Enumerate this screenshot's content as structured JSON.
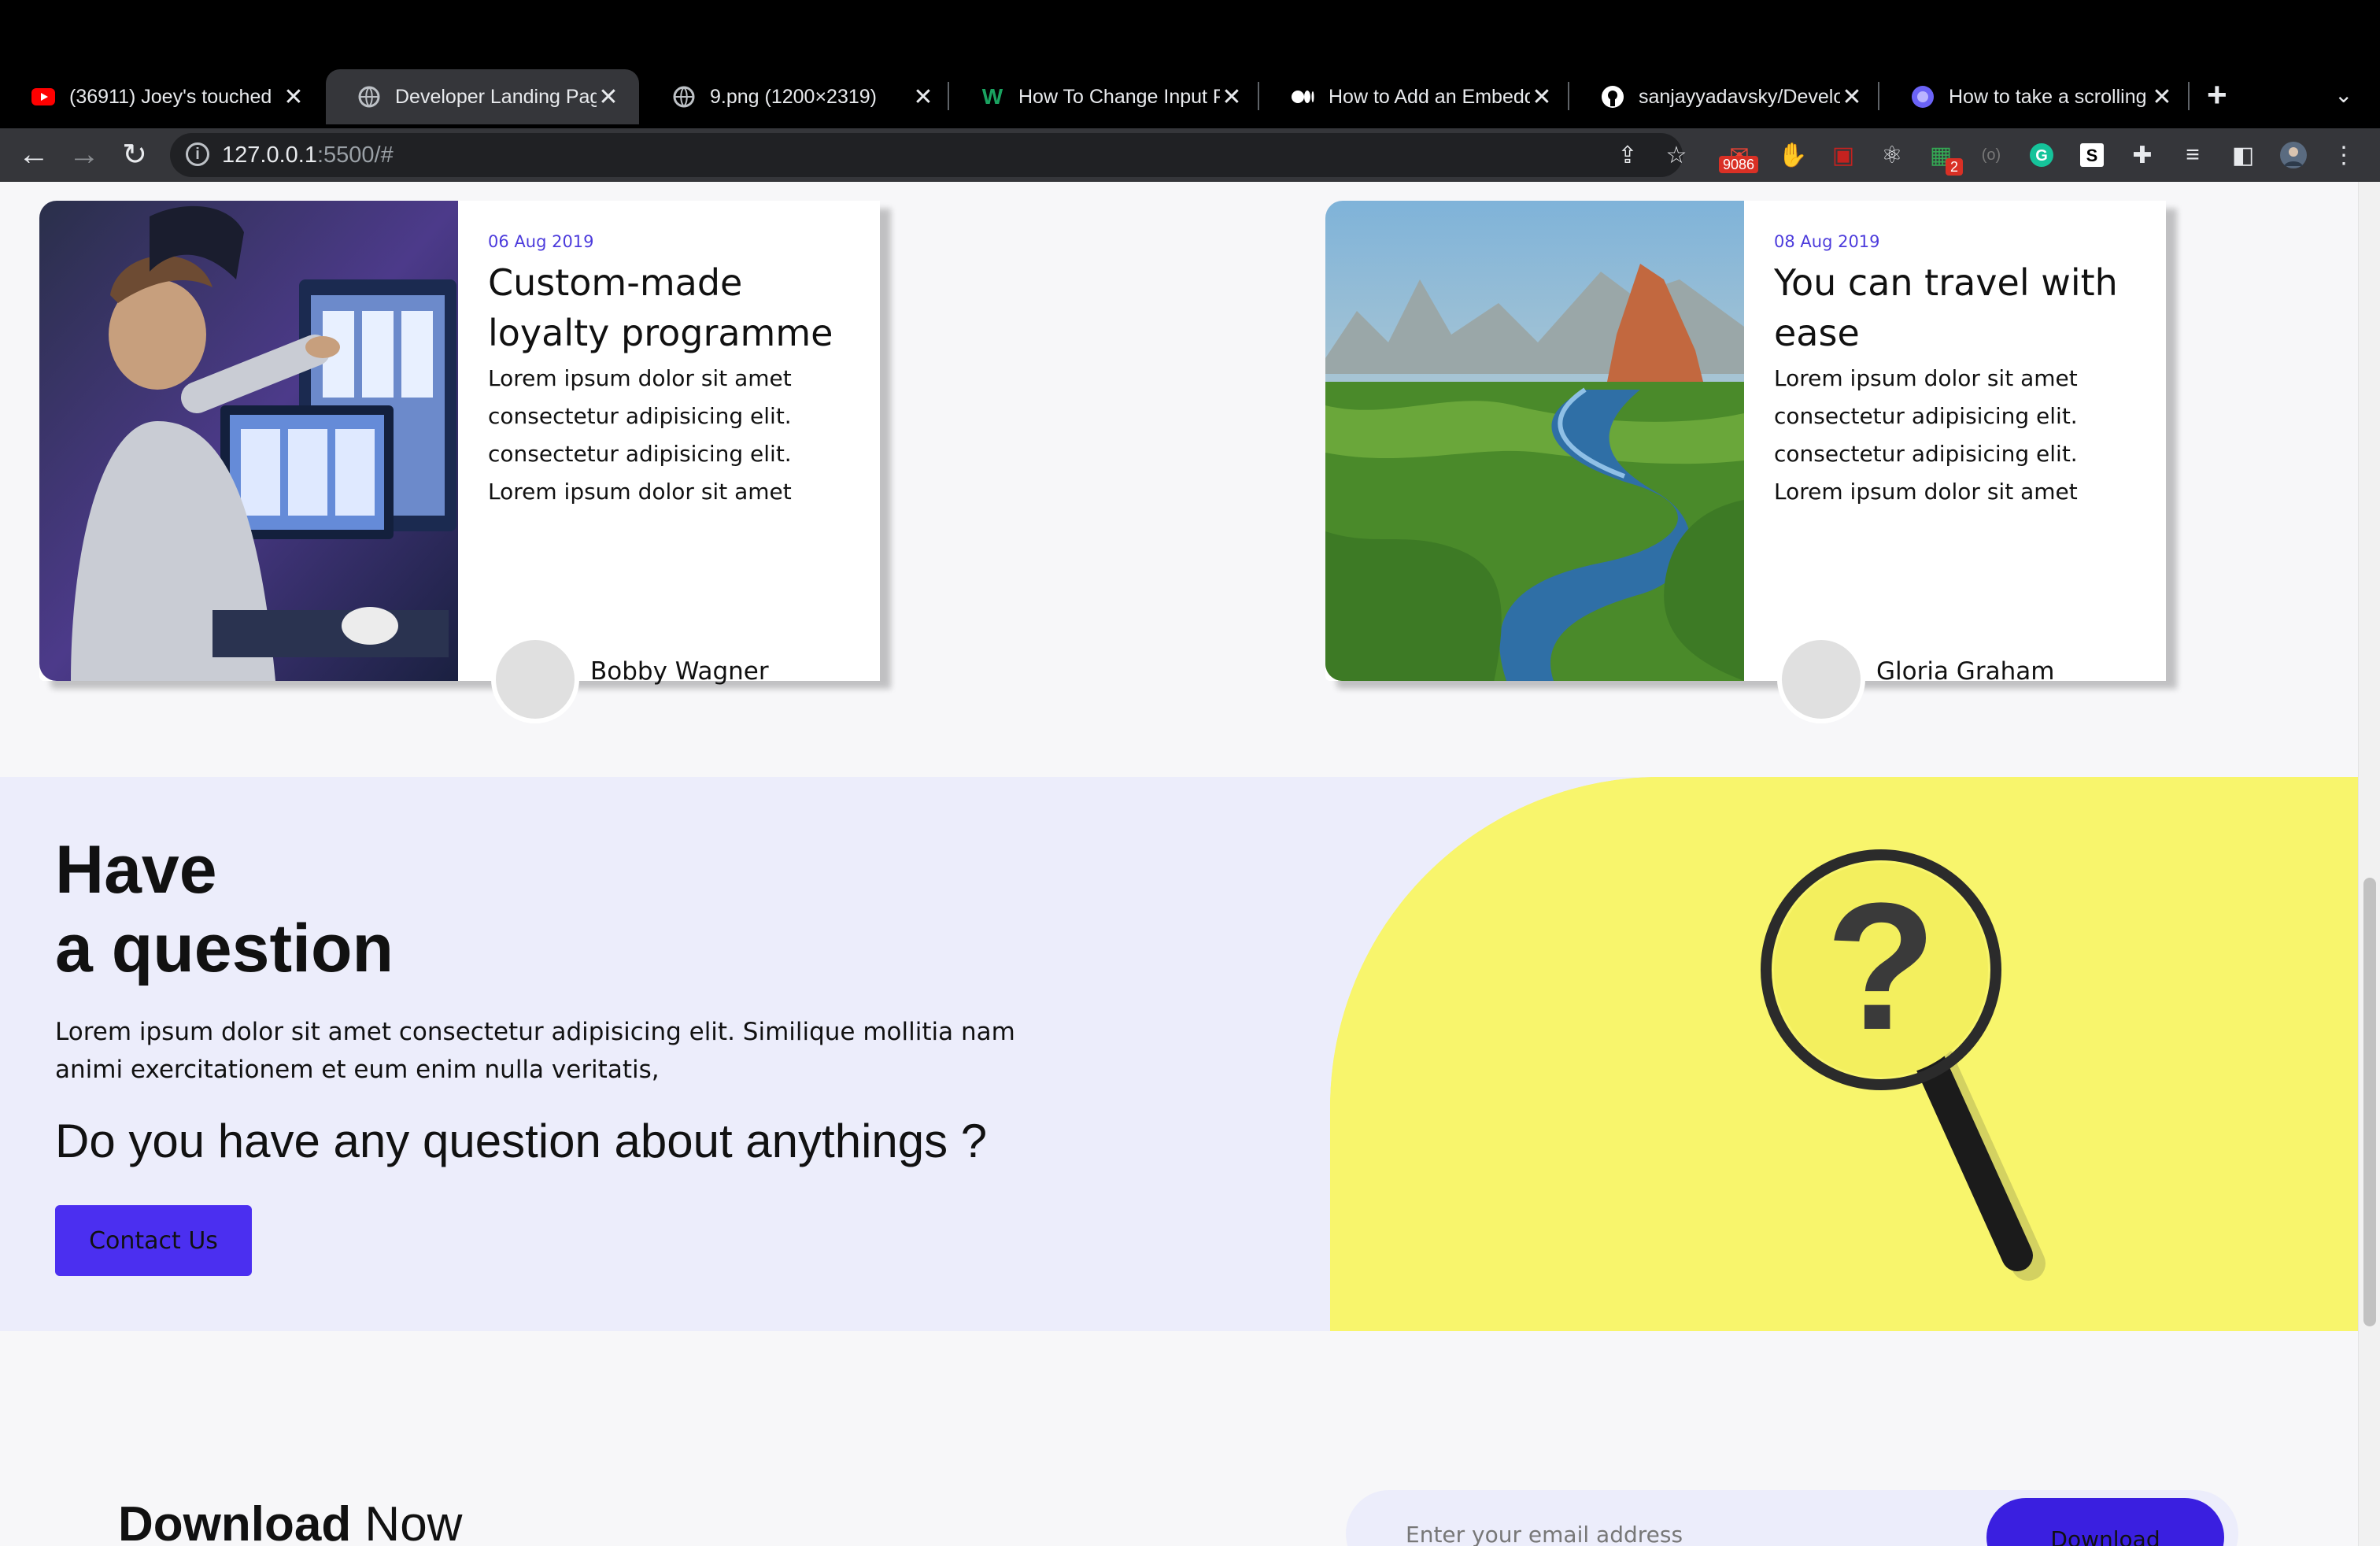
{
  "browser": {
    "tabs": [
      {
        "title": "(36911) Joey's touched",
        "icon": "youtube-icon"
      },
      {
        "title": "Developer Landing Page",
        "icon": "globe-icon",
        "active": true
      },
      {
        "title": "9.png (1200×2319)",
        "icon": "globe-icon"
      },
      {
        "title": "How To Change Input Placeholder",
        "icon": "w-logo-icon"
      },
      {
        "title": "How to Add an Embedded",
        "icon": "medium-icon"
      },
      {
        "title": "sanjayyadavsky/Developer",
        "icon": "github-icon"
      },
      {
        "title": "How to take a scrolling",
        "icon": "site-icon"
      }
    ],
    "url_host": "127.0.0.1",
    "url_rest": ":5500/#",
    "extension_badge": "9086",
    "extension_badge_small": "2"
  },
  "cards": [
    {
      "date": "06 Aug 2019",
      "title": "Custom-made loyalty programme",
      "lines": [
        "Lorem ipsum dolor sit amet",
        "consectetur adipisicing elit.",
        "consectetur adipisicing elit.",
        "Lorem ipsum dolor sit amet"
      ],
      "author": "Bobby Wagner",
      "image": "woman-at-monitors-photo"
    },
    {
      "date": "08 Aug 2019",
      "title": "You can travel with ease",
      "lines": [
        "Lorem ipsum dolor sit amet",
        "consectetur adipisicing elit.",
        "consectetur adipisicing elit.",
        "Lorem ipsum dolor sit amet"
      ],
      "author": "Gloria Graham",
      "image": "river-landscape-photo"
    }
  ],
  "question": {
    "heading_line1": "Have",
    "heading_line2": "a question",
    "paragraph": "Lorem ipsum dolor sit amet consectetur adipisicing elit. Similique mollitia nam animi exercitationem et eum enim nulla veritatis,",
    "ask": "Do you have any question about anythings ?",
    "button": "Contact Us",
    "image": "magnifier-question-photo"
  },
  "download": {
    "title_bold": "Download",
    "title_rest": " Now",
    "placeholder": "Enter your email address",
    "button": "Download"
  },
  "colors": {
    "accent": "#4b2ff0",
    "date": "#4c3bdc",
    "section_bg": "#ecedfb",
    "yellow": "#f8f56c"
  }
}
